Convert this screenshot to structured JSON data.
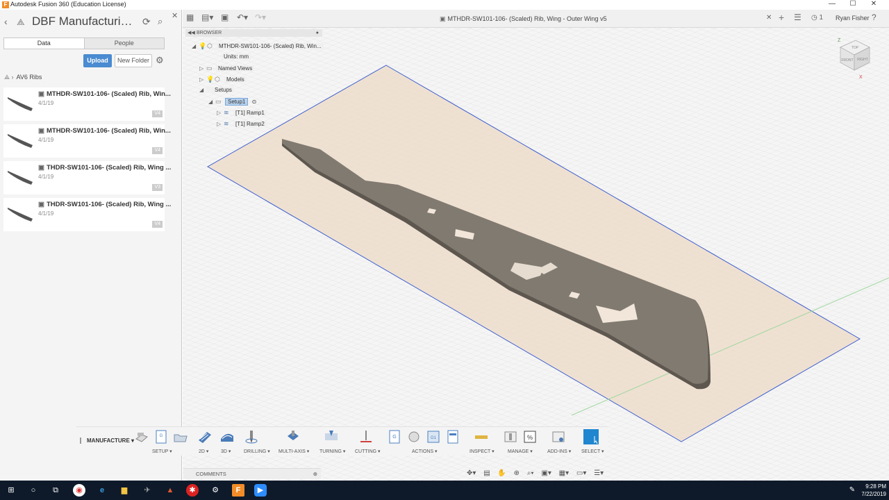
{
  "window": {
    "title": "Autodesk Fusion 360 (Education License)",
    "minimize": "—",
    "maximize": "☐",
    "close": "✕"
  },
  "data_panel": {
    "project_title": "DBF Manufacturi…",
    "tabs": [
      {
        "label": "Data",
        "active": true
      },
      {
        "label": "People",
        "active": false
      }
    ],
    "upload_label": "Upload",
    "new_folder_label": "New Folder",
    "folder_name": "AV6 Ribs",
    "files": [
      {
        "name": "MTHDR-SW101-106- (Scaled) Rib, Win...",
        "date": "4/1/19",
        "version": "V4"
      },
      {
        "name": "MTHDR-SW101-106- (Scaled) Rib, Win...",
        "date": "4/1/19",
        "version": "V4"
      },
      {
        "name": "THDR-SW101-106- (Scaled) Rib, Wing ...",
        "date": "4/1/19",
        "version": "V3"
      },
      {
        "name": "THDR-SW101-106- (Scaled) Rib, Wing ...",
        "date": "4/1/19",
        "version": "V4"
      }
    ]
  },
  "toolbar": {
    "document_tab": "MTHDR-SW101-106- (Scaled) Rib, Wing - Outer Wing v5",
    "job_count": "1",
    "user_name": "Ryan Fisher"
  },
  "browser": {
    "header": "BROWSER",
    "root": "MTHDR-SW101-106- (Scaled) Rib, Win...",
    "units": "Units: mm",
    "named_views": "Named Views",
    "models": "Models",
    "setups": "Setups",
    "setup1": "Setup1",
    "operations": [
      "[T1] Ramp1",
      "[T1] Ramp2"
    ]
  },
  "viewcube": {
    "top": "TOP",
    "front": "FRONT",
    "right": "RIGHT"
  },
  "manufacture_toolbar": {
    "workspace": "MANUFACTURE ▾",
    "groups": [
      {
        "label": "SETUP ▾"
      },
      {
        "label": "2D ▾"
      },
      {
        "label": "3D ▾"
      },
      {
        "label": "DRILLING ▾"
      },
      {
        "label": "MULTI-AXIS ▾"
      },
      {
        "label": "TURNING ▾"
      },
      {
        "label": "CUTTING ▾"
      },
      {
        "label": "ACTIONS ▾"
      },
      {
        "label": "INSPECT ▾"
      },
      {
        "label": "MANAGE ▾"
      },
      {
        "label": "ADD-INS ▾"
      },
      {
        "label": "SELECT ▾"
      }
    ]
  },
  "comments_label": "COMMENTS",
  "clock": {
    "time": "9:28 PM",
    "date": "7/22/2019"
  },
  "colors": {
    "accent": "#4a8bd1",
    "part": "#817a70",
    "stock_plane": "#ecd9c6",
    "stock_outline": "#3d5fd0"
  }
}
